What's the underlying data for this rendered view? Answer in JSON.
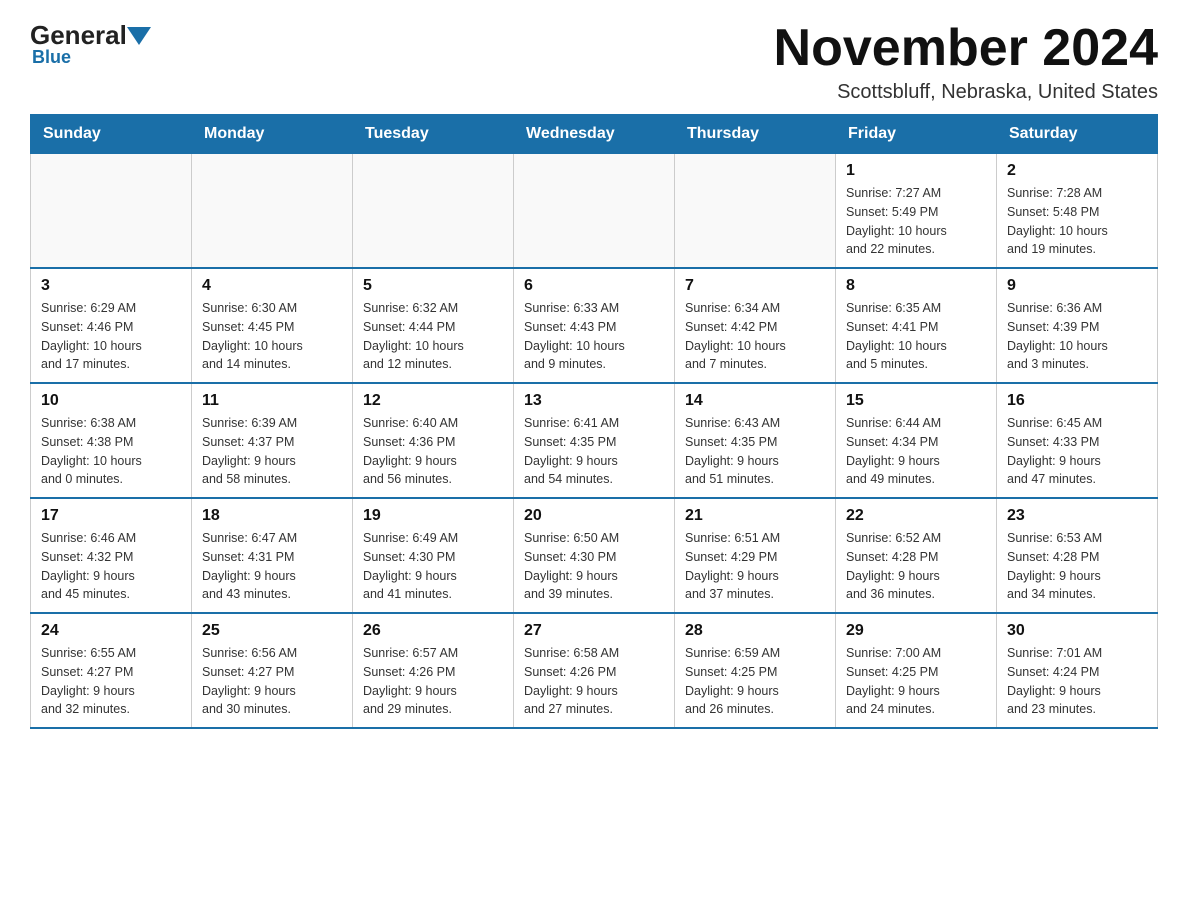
{
  "logo": {
    "general": "General",
    "blue": "Blue"
  },
  "title": "November 2024",
  "subtitle": "Scottsbluff, Nebraska, United States",
  "weekdays": [
    "Sunday",
    "Monday",
    "Tuesday",
    "Wednesday",
    "Thursday",
    "Friday",
    "Saturday"
  ],
  "weeks": [
    [
      {
        "day": "",
        "info": ""
      },
      {
        "day": "",
        "info": ""
      },
      {
        "day": "",
        "info": ""
      },
      {
        "day": "",
        "info": ""
      },
      {
        "day": "",
        "info": ""
      },
      {
        "day": "1",
        "info": "Sunrise: 7:27 AM\nSunset: 5:49 PM\nDaylight: 10 hours\nand 22 minutes."
      },
      {
        "day": "2",
        "info": "Sunrise: 7:28 AM\nSunset: 5:48 PM\nDaylight: 10 hours\nand 19 minutes."
      }
    ],
    [
      {
        "day": "3",
        "info": "Sunrise: 6:29 AM\nSunset: 4:46 PM\nDaylight: 10 hours\nand 17 minutes."
      },
      {
        "day": "4",
        "info": "Sunrise: 6:30 AM\nSunset: 4:45 PM\nDaylight: 10 hours\nand 14 minutes."
      },
      {
        "day": "5",
        "info": "Sunrise: 6:32 AM\nSunset: 4:44 PM\nDaylight: 10 hours\nand 12 minutes."
      },
      {
        "day": "6",
        "info": "Sunrise: 6:33 AM\nSunset: 4:43 PM\nDaylight: 10 hours\nand 9 minutes."
      },
      {
        "day": "7",
        "info": "Sunrise: 6:34 AM\nSunset: 4:42 PM\nDaylight: 10 hours\nand 7 minutes."
      },
      {
        "day": "8",
        "info": "Sunrise: 6:35 AM\nSunset: 4:41 PM\nDaylight: 10 hours\nand 5 minutes."
      },
      {
        "day": "9",
        "info": "Sunrise: 6:36 AM\nSunset: 4:39 PM\nDaylight: 10 hours\nand 3 minutes."
      }
    ],
    [
      {
        "day": "10",
        "info": "Sunrise: 6:38 AM\nSunset: 4:38 PM\nDaylight: 10 hours\nand 0 minutes."
      },
      {
        "day": "11",
        "info": "Sunrise: 6:39 AM\nSunset: 4:37 PM\nDaylight: 9 hours\nand 58 minutes."
      },
      {
        "day": "12",
        "info": "Sunrise: 6:40 AM\nSunset: 4:36 PM\nDaylight: 9 hours\nand 56 minutes."
      },
      {
        "day": "13",
        "info": "Sunrise: 6:41 AM\nSunset: 4:35 PM\nDaylight: 9 hours\nand 54 minutes."
      },
      {
        "day": "14",
        "info": "Sunrise: 6:43 AM\nSunset: 4:35 PM\nDaylight: 9 hours\nand 51 minutes."
      },
      {
        "day": "15",
        "info": "Sunrise: 6:44 AM\nSunset: 4:34 PM\nDaylight: 9 hours\nand 49 minutes."
      },
      {
        "day": "16",
        "info": "Sunrise: 6:45 AM\nSunset: 4:33 PM\nDaylight: 9 hours\nand 47 minutes."
      }
    ],
    [
      {
        "day": "17",
        "info": "Sunrise: 6:46 AM\nSunset: 4:32 PM\nDaylight: 9 hours\nand 45 minutes."
      },
      {
        "day": "18",
        "info": "Sunrise: 6:47 AM\nSunset: 4:31 PM\nDaylight: 9 hours\nand 43 minutes."
      },
      {
        "day": "19",
        "info": "Sunrise: 6:49 AM\nSunset: 4:30 PM\nDaylight: 9 hours\nand 41 minutes."
      },
      {
        "day": "20",
        "info": "Sunrise: 6:50 AM\nSunset: 4:30 PM\nDaylight: 9 hours\nand 39 minutes."
      },
      {
        "day": "21",
        "info": "Sunrise: 6:51 AM\nSunset: 4:29 PM\nDaylight: 9 hours\nand 37 minutes."
      },
      {
        "day": "22",
        "info": "Sunrise: 6:52 AM\nSunset: 4:28 PM\nDaylight: 9 hours\nand 36 minutes."
      },
      {
        "day": "23",
        "info": "Sunrise: 6:53 AM\nSunset: 4:28 PM\nDaylight: 9 hours\nand 34 minutes."
      }
    ],
    [
      {
        "day": "24",
        "info": "Sunrise: 6:55 AM\nSunset: 4:27 PM\nDaylight: 9 hours\nand 32 minutes."
      },
      {
        "day": "25",
        "info": "Sunrise: 6:56 AM\nSunset: 4:27 PM\nDaylight: 9 hours\nand 30 minutes."
      },
      {
        "day": "26",
        "info": "Sunrise: 6:57 AM\nSunset: 4:26 PM\nDaylight: 9 hours\nand 29 minutes."
      },
      {
        "day": "27",
        "info": "Sunrise: 6:58 AM\nSunset: 4:26 PM\nDaylight: 9 hours\nand 27 minutes."
      },
      {
        "day": "28",
        "info": "Sunrise: 6:59 AM\nSunset: 4:25 PM\nDaylight: 9 hours\nand 26 minutes."
      },
      {
        "day": "29",
        "info": "Sunrise: 7:00 AM\nSunset: 4:25 PM\nDaylight: 9 hours\nand 24 minutes."
      },
      {
        "day": "30",
        "info": "Sunrise: 7:01 AM\nSunset: 4:24 PM\nDaylight: 9 hours\nand 23 minutes."
      }
    ]
  ]
}
